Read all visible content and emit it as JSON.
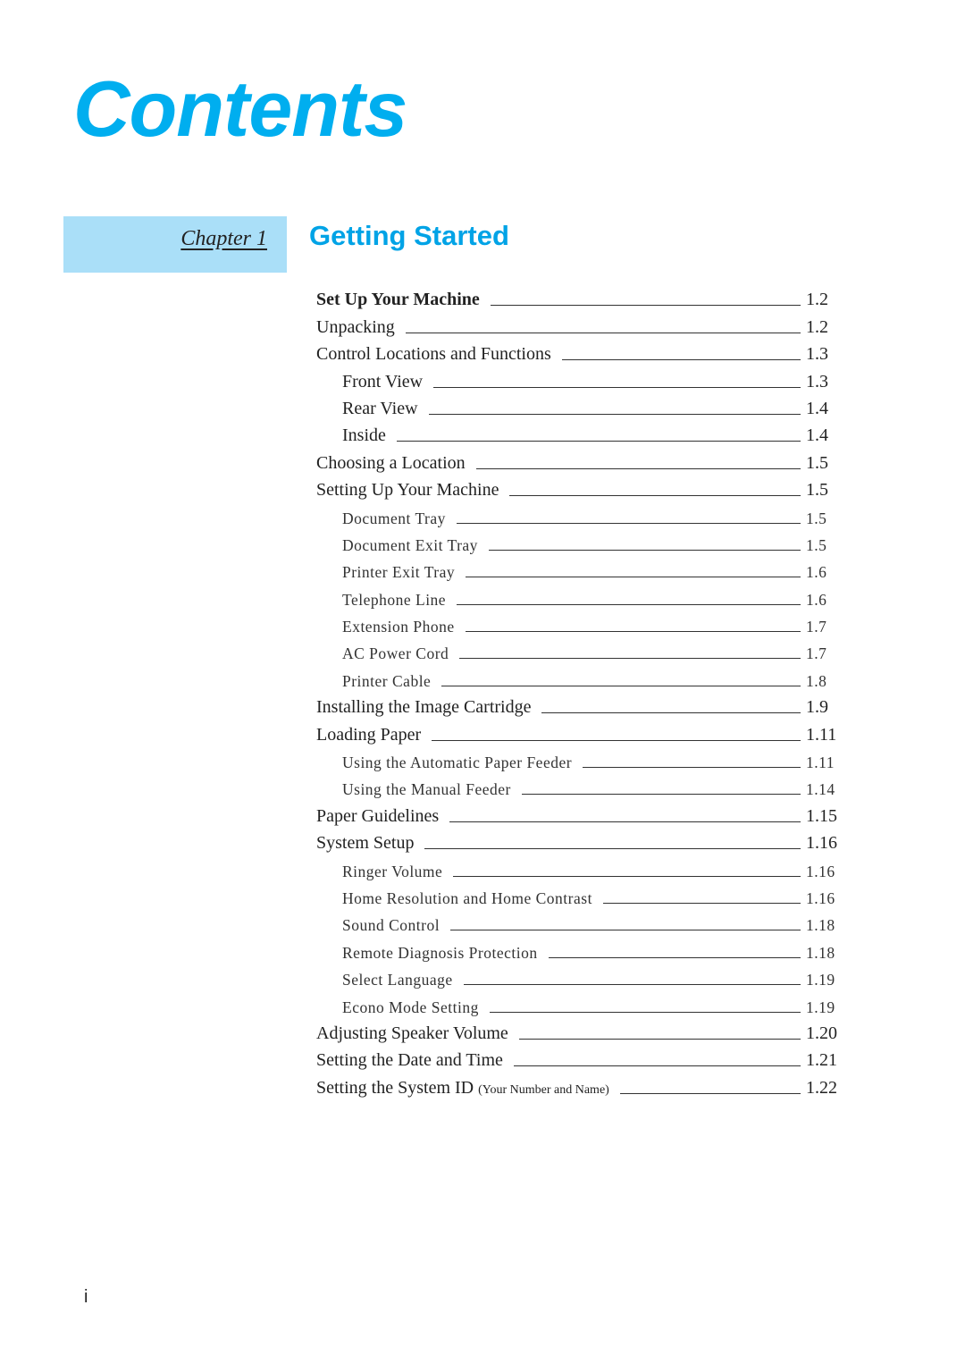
{
  "page_title": "Contents",
  "chapter": {
    "label": "Chapter 1",
    "title": "Getting Started"
  },
  "toc": [
    {
      "title": "Set Up Your Machine",
      "page": "1.2",
      "level": 1,
      "bold": true
    },
    {
      "title": "Unpacking",
      "page": "1.2",
      "level": 1
    },
    {
      "title": "Control Locations and Functions",
      "page": "1.3",
      "level": 1
    },
    {
      "title": "Front View",
      "page": "1.3",
      "level": 2
    },
    {
      "title": "Rear View",
      "page": "1.4",
      "level": 2
    },
    {
      "title": "Inside",
      "page": "1.4",
      "level": 2
    },
    {
      "title": "Choosing a Location",
      "page": "1.5",
      "level": 1
    },
    {
      "title": "Setting Up Your Machine",
      "page": "1.5",
      "level": 1
    },
    {
      "title": "Document Tray",
      "page": "1.5",
      "level": 3
    },
    {
      "title": "Document Exit Tray",
      "page": "1.5",
      "level": 3
    },
    {
      "title": "Printer Exit Tray",
      "page": "1.6",
      "level": 3
    },
    {
      "title": "Telephone Line",
      "page": "1.6",
      "level": 3
    },
    {
      "title": "Extension Phone",
      "page": "1.7",
      "level": 3
    },
    {
      "title": "AC Power Cord",
      "page": "1.7",
      "level": 3
    },
    {
      "title": "Printer Cable",
      "page": "1.8",
      "level": 3
    },
    {
      "title": "Installing the Image Cartridge",
      "page": "1.9",
      "level": 1
    },
    {
      "title": "Loading Paper",
      "page": "1.11",
      "level": 1
    },
    {
      "title": "Using the Automatic Paper Feeder",
      "page": "1.11",
      "level": 3
    },
    {
      "title": "Using the Manual Feeder",
      "page": "1.14",
      "level": 3
    },
    {
      "title": "Paper Guidelines",
      "page": "1.15",
      "level": 1
    },
    {
      "title": "System Setup",
      "page": "1.16",
      "level": 1
    },
    {
      "title": "Ringer Volume",
      "page": "1.16",
      "level": 3
    },
    {
      "title": "Home Resolution and Home Contrast",
      "page": "1.16",
      "level": 3
    },
    {
      "title": "Sound Control",
      "page": "1.18",
      "level": 3
    },
    {
      "title": "Remote Diagnosis Protection",
      "page": "1.18",
      "level": 3
    },
    {
      "title": "Select Language",
      "page": "1.19",
      "level": 3
    },
    {
      "title": "Econo Mode Setting",
      "page": "1.19",
      "level": 3
    },
    {
      "title": "Adjusting Speaker Volume",
      "page": "1.20",
      "level": 1
    },
    {
      "title": "Setting the Date and Time",
      "page": "1.21",
      "level": 1
    },
    {
      "title": "Setting the System ID",
      "note": "(Your Number and Name)",
      "page": "1.22",
      "level": 1
    }
  ],
  "page_number": "i"
}
